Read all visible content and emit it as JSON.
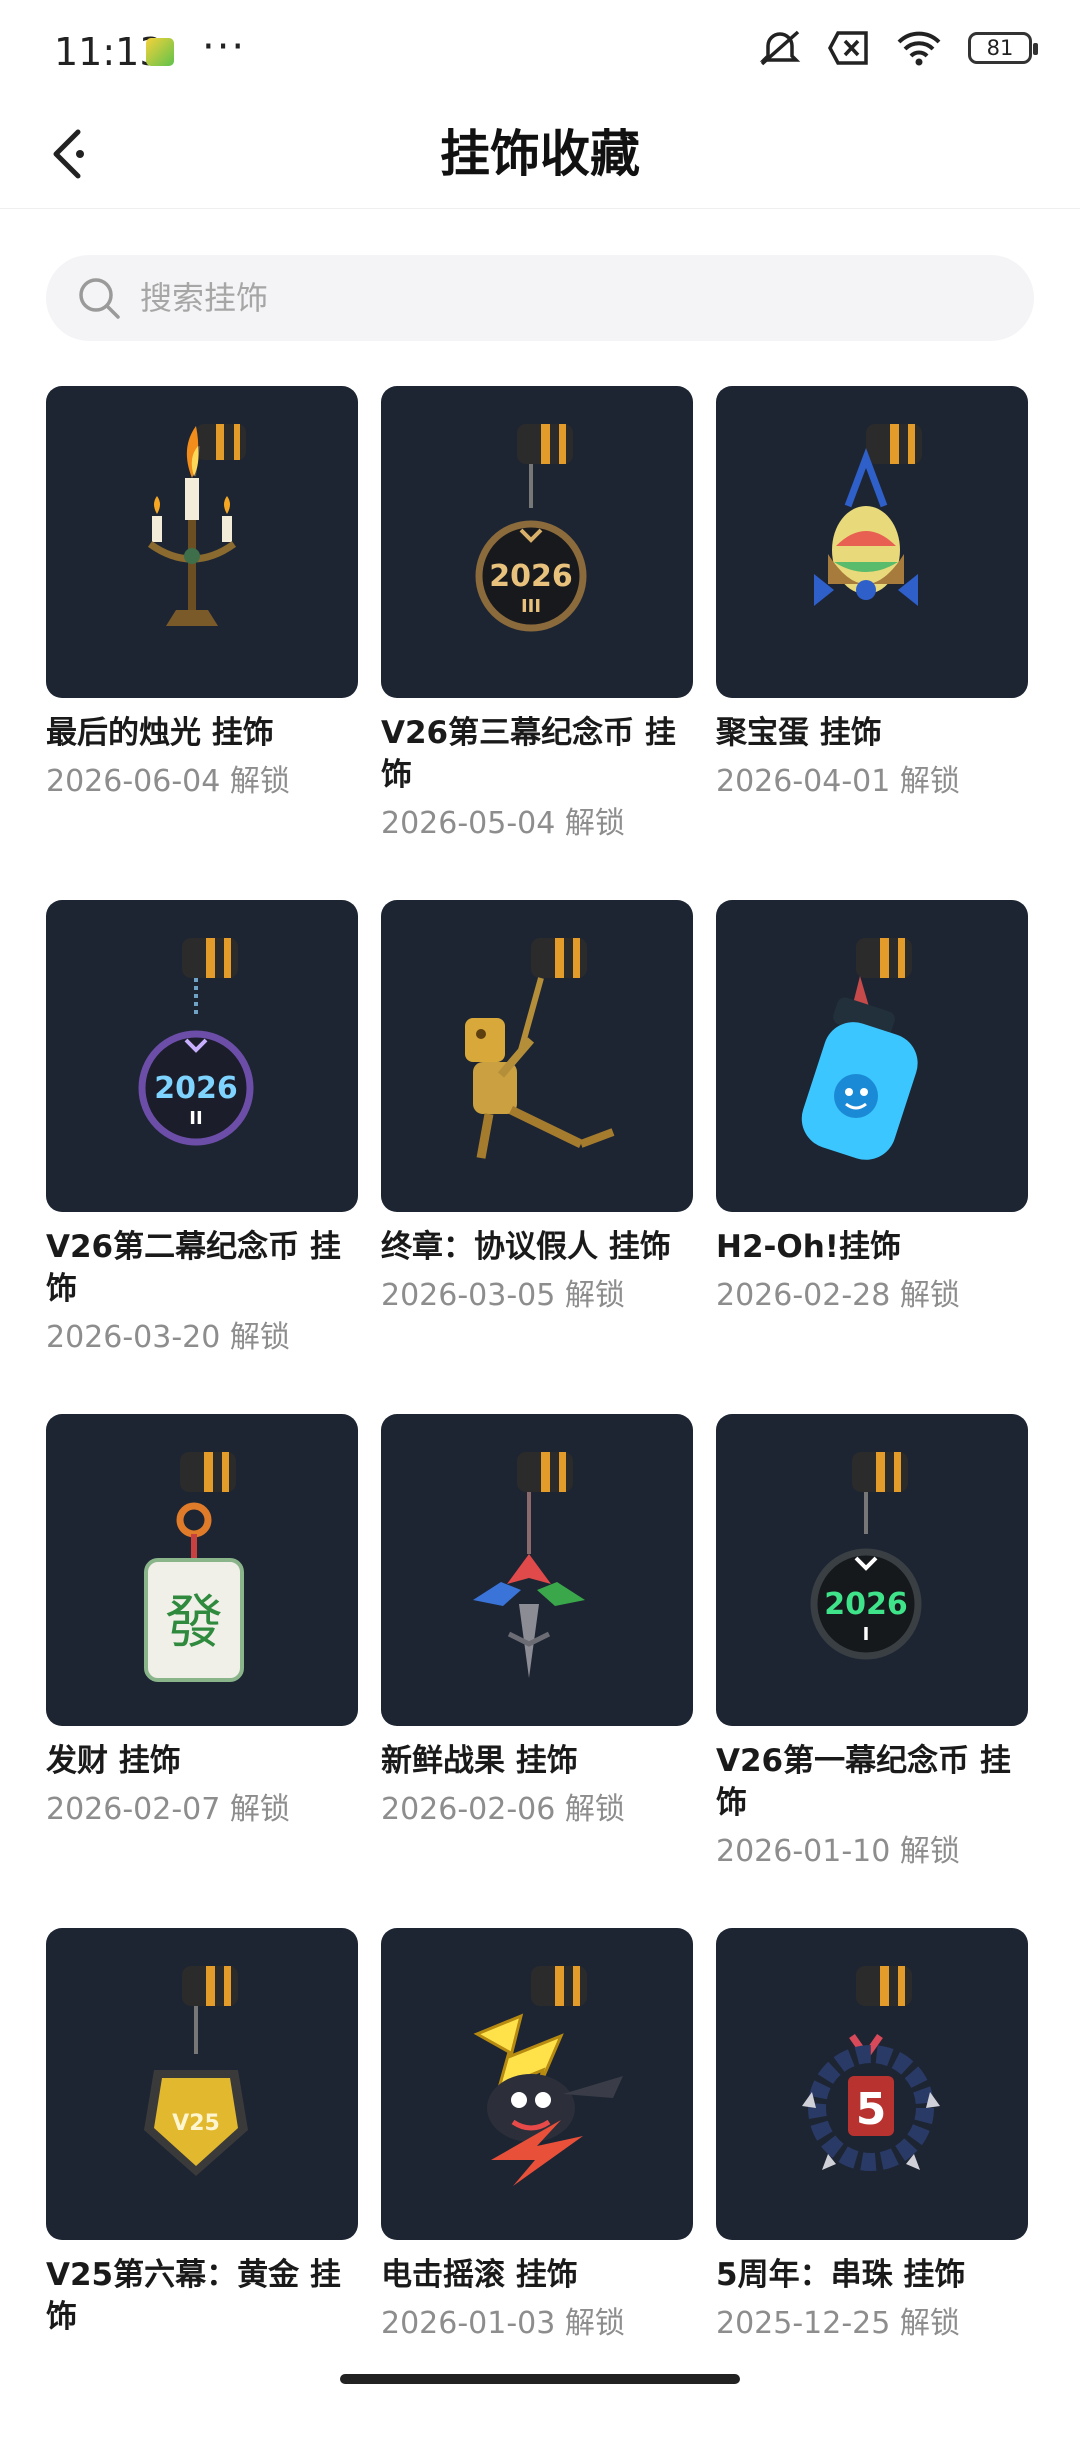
{
  "status_bar": {
    "time": "11:13",
    "battery": "81"
  },
  "header": {
    "title": "挂饰收藏"
  },
  "search": {
    "placeholder": "搜索挂饰"
  },
  "items": [
    {
      "name": "最后的烛光 挂饰",
      "date": "2026-06-04 解锁",
      "icon": "candelabra-charm"
    },
    {
      "name": "V26第三幕纪念币 挂饰",
      "date": "2026-05-04 解锁",
      "icon": "coin-2026-III"
    },
    {
      "name": "聚宝蛋 挂饰",
      "date": "2026-04-01 解锁",
      "icon": "egg-basket-charm"
    },
    {
      "name": "V26第二幕纪念币 挂饰",
      "date": "2026-03-20 解锁",
      "icon": "coin-2026-II"
    },
    {
      "name": "终章：协议假人 挂饰",
      "date": "2026-03-05 解锁",
      "icon": "dummy-charm"
    },
    {
      "name": "H2-Oh!挂饰",
      "date": "2026-02-28 解锁",
      "icon": "water-bottle-charm"
    },
    {
      "name": "发财 挂饰",
      "date": "2026-02-07 解锁",
      "icon": "mahjong-tile-charm"
    },
    {
      "name": "新鲜战果 挂饰",
      "date": "2026-02-06 解锁",
      "icon": "leaf-charm"
    },
    {
      "name": "V26第一幕纪念币 挂饰",
      "date": "2026-01-10 解锁",
      "icon": "coin-2026-I"
    },
    {
      "name": "V25第六幕：黄金 挂饰",
      "date": "",
      "icon": "gold-rank-charm"
    },
    {
      "name": "电击摇滚 挂饰",
      "date": "2026-01-03 解锁",
      "icon": "lightning-charm"
    },
    {
      "name": "5周年：串珠 挂饰",
      "date": "2025-12-25 解锁",
      "icon": "beads-5-charm"
    }
  ],
  "charm_text": {
    "coin_year": "2026",
    "coin_act_3": "III",
    "coin_act_2": "II",
    "coin_act_1": "I",
    "gold_badge": "V25",
    "beads_number": "5",
    "mahjong_glyph": "發"
  },
  "colors": {
    "card_bg": "#1d2533",
    "date_gray": "#8d8d8d",
    "search_bg": "#f4f4f6"
  }
}
